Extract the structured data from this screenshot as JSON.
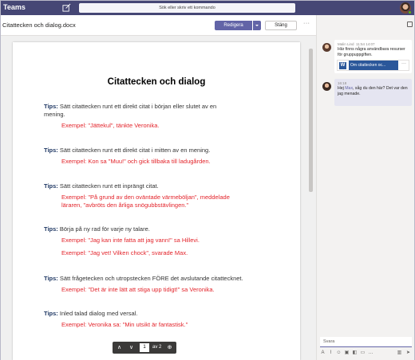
{
  "app": {
    "title": "Teams"
  },
  "search": {
    "placeholder": "Sök eller skriv ett kommando"
  },
  "document": {
    "file_name": "Citattecken och dialog.docx",
    "edit_label": "Redigera",
    "close_label": "Stäng",
    "more_label": "···",
    "heading": "Citattecken och dialog",
    "tip_label": "Tips:",
    "tips": [
      {
        "text": "Sätt citattecken runt ett direkt citat i början eller slutet av en",
        "text2": "mening.",
        "example": "Exempel: \"Jättekul\", tänkte Veronika.",
        "example2": ""
      },
      {
        "text": "Sätt citattecken runt ett direkt citat i mitten av en mening.",
        "text2": "",
        "example": "Exempel: Kon sa \"Muu!\" och gick tillbaka till ladugården.",
        "example2": ""
      },
      {
        "text": "Sätt citattecken runt ett inprängt citat.",
        "text2": "",
        "example": "Exempel: \"På grund av den oväntade värmeböljan\", meddelade",
        "example2": "läraren, \"avbröts den årliga snögubbstävlingen.\""
      },
      {
        "text": "Börja på ny rad för varje ny talare.",
        "text2": "",
        "example": "Exempel: \"Jag kan inte fatta att jag vann!\" sa Hillevi.",
        "example2": "Exempel: \"Jag vet! Vilken chock\", svarade Max."
      },
      {
        "text": "Sätt frågetecken och utropstecken FÖRE det avslutande citattecknet.",
        "text2": "",
        "example": "Exempel: \"Det är inte lätt att stiga upp tidigt!\" sa Veronika.",
        "example2": ""
      },
      {
        "text": "Inled talad dialog med versal.",
        "text2": "",
        "example": "Exempel: Veronika sa: \"Min utsikt är fantastisk.\"",
        "example2": ""
      }
    ],
    "page_nav": {
      "prev": "∧",
      "next": "∨",
      "current": "1",
      "of_label": "av 2",
      "zoom": "⊕"
    }
  },
  "chat": {
    "messages": [
      {
        "author": "Malin Lind",
        "time": "11:54 14:07",
        "text": "Här finns några användbara resurser för gruppuppgiften.",
        "attachment": "Om citattecken oc..."
      },
      {
        "author": "",
        "time": "16:18",
        "text_before": "Hej ",
        "mention": "Max",
        "text_after": ", såg du den här? Det var den jag menade."
      }
    ],
    "reply_placeholder": "Svara"
  },
  "colors": {
    "titlebar": "#464775",
    "accent": "#6264a7",
    "tip_label": "#1f3864",
    "example": "#e3242b",
    "word": "#2b579a"
  },
  "icons": [
    "compose-icon",
    "avatar",
    "chevron-down-icon",
    "more-icon",
    "word-icon",
    "chat-info-icon"
  ]
}
